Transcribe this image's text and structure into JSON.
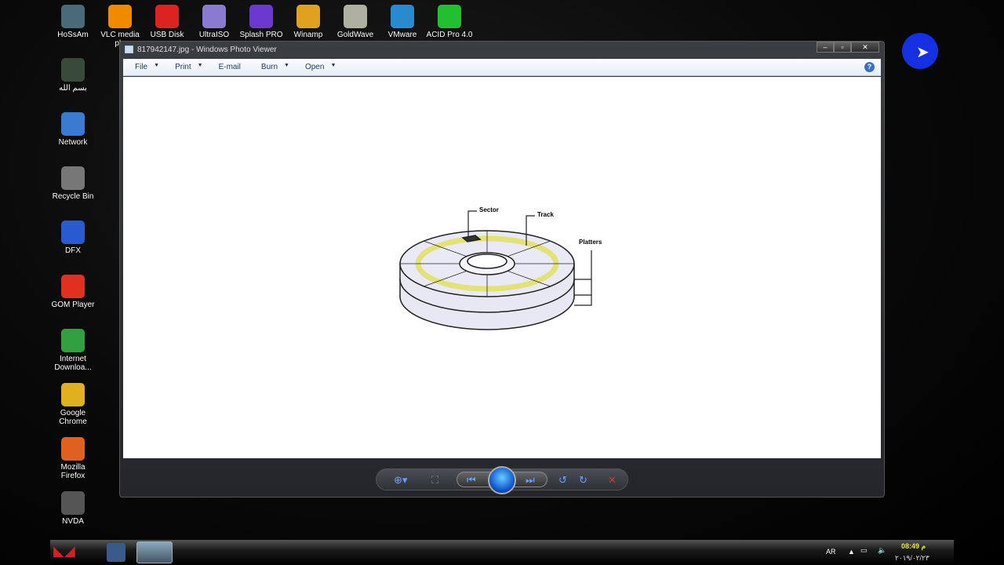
{
  "desktop": {
    "top_icons": [
      {
        "label": "HoSsAm",
        "color": "#4a6a7a"
      },
      {
        "label": "VLC media pl..",
        "color": "#f08a00"
      },
      {
        "label": "USB Disk",
        "color": "#d22"
      },
      {
        "label": "UltraISO",
        "color": "#8a7ad0"
      },
      {
        "label": "Splash PRO",
        "color": "#6a3ad0"
      },
      {
        "label": "Winamp",
        "color": "#e0a020"
      },
      {
        "label": "GoldWave",
        "color": "#b0b0a0"
      },
      {
        "label": "VMware",
        "color": "#2a8ad0"
      },
      {
        "label": "ACID Pro 4.0",
        "color": "#22c030"
      }
    ],
    "left_icons": [
      {
        "label": "بسم الله",
        "color": "#3a4a3a"
      },
      {
        "label": "Network",
        "color": "#3a7ad0"
      },
      {
        "label": "Recycle Bin",
        "color": "#777"
      },
      {
        "label": "DFX",
        "color": "#2a5ad0"
      },
      {
        "label": "GOM Player",
        "color": "#e03020"
      },
      {
        "label": "Internet Downloa...",
        "color": "#30a040"
      },
      {
        "label": "Google Chrome",
        "color": "#e0b020"
      },
      {
        "label": "Mozilla Firefox",
        "color": "#e06020"
      },
      {
        "label": "NVDA",
        "color": "#555"
      }
    ]
  },
  "window": {
    "title": "817942147.jpg - Windows Photo Viewer",
    "controls": [
      "minimize",
      "maximize",
      "close"
    ],
    "menu": [
      {
        "label": "File",
        "dropdown": true
      },
      {
        "label": "Print",
        "dropdown": true
      },
      {
        "label": "E-mail",
        "dropdown": false
      },
      {
        "label": "Burn",
        "dropdown": true
      },
      {
        "label": "Open",
        "dropdown": true
      }
    ],
    "help": "?"
  },
  "image": {
    "labels": {
      "sector": "Sector",
      "track": "Track",
      "platters": "Platters"
    },
    "track_color": "#f3f29a"
  },
  "toolbar": {
    "buttons": [
      "zoom",
      "fit",
      "previous",
      "slideshow",
      "next",
      "rotate-left",
      "rotate-right",
      "delete"
    ]
  },
  "taskbar": {
    "language": "AR",
    "time": "08:49 م",
    "date": "٢٠١٩/٠٢/٢٣"
  }
}
